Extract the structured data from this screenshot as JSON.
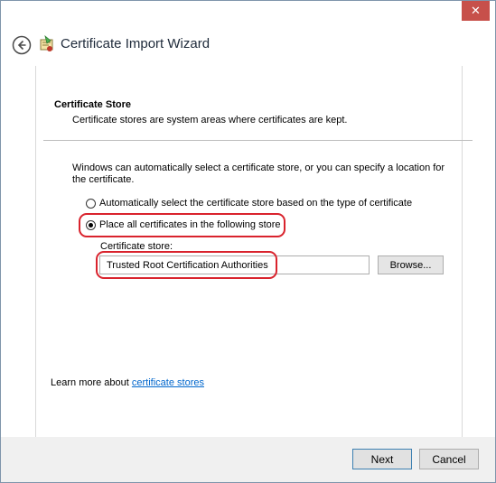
{
  "window": {
    "title": "Certificate Import Wizard",
    "close_glyph": "✕"
  },
  "section": {
    "title": "Certificate Store",
    "description": "Certificate stores are system areas where certificates are kept."
  },
  "intro": "Windows can automatically select a certificate store, or you can specify a location for the certificate.",
  "options": {
    "auto": {
      "label": "Automatically select the certificate store based on the type of certificate",
      "selected": false
    },
    "manual": {
      "label": "Place all certificates in the following store",
      "selected": true
    }
  },
  "store": {
    "label": "Certificate store:",
    "value": "Trusted Root Certification Authorities",
    "browse_label": "Browse..."
  },
  "learn_more": {
    "prefix": "Learn more about ",
    "link": "certificate stores"
  },
  "buttons": {
    "next": "Next",
    "cancel": "Cancel"
  },
  "colors": {
    "highlight": "#d9232d",
    "link": "#0066cc",
    "close": "#c7504a"
  },
  "icons": [
    "close-icon",
    "back-arrow-icon",
    "certificate-wizard-icon"
  ]
}
